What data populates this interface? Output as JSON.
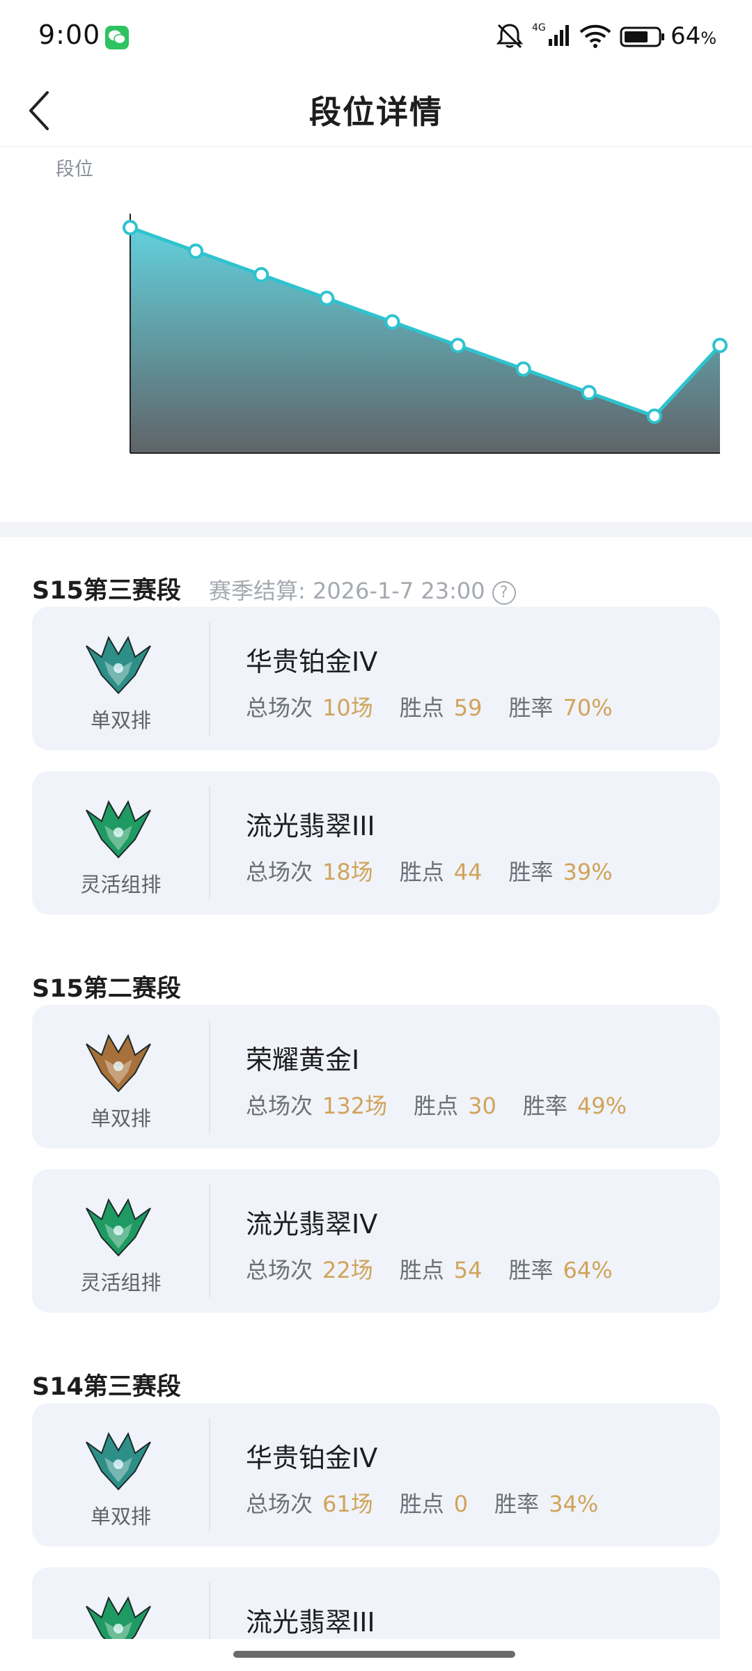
{
  "status_bar": {
    "time": "9:00",
    "network": "4G",
    "battery_percent": "64",
    "battery_unit": "%"
  },
  "header": {
    "title": "段位详情"
  },
  "chart_data": {
    "type": "area",
    "ylabel": "段位",
    "xlabel": "",
    "title": "",
    "x": [
      1,
      2,
      3,
      4,
      5,
      6,
      7,
      8,
      9,
      10
    ],
    "series": [
      {
        "values": [
          10,
          9,
          8,
          7,
          6,
          5,
          4,
          3,
          2,
          5
        ]
      }
    ],
    "grid": false,
    "colors": {
      "line": "#2ec3cf",
      "fill_top": "#63d0dc",
      "fill_bottom": "#5f6468"
    }
  },
  "seasons": [
    {
      "title": "S15第三赛段",
      "settle_text": "赛季结算: 2026-1-7 23:00",
      "help": "?",
      "cards": [
        {
          "emblem": "platinum",
          "queue": "单双排",
          "rank": "华贵铂金IV",
          "games_label": "总场次",
          "games": "10场",
          "points_label": "胜点",
          "points": "59",
          "winrate_label": "胜率",
          "winrate": "70%"
        },
        {
          "emblem": "emerald",
          "queue": "灵活组排",
          "rank": "流光翡翠III",
          "games_label": "总场次",
          "games": "18场",
          "points_label": "胜点",
          "points": "44",
          "winrate_label": "胜率",
          "winrate": "39%"
        }
      ]
    },
    {
      "title": "S15第二赛段",
      "settle_text": "",
      "help": "",
      "cards": [
        {
          "emblem": "gold",
          "queue": "单双排",
          "rank": "荣耀黄金I",
          "games_label": "总场次",
          "games": "132场",
          "points_label": "胜点",
          "points": "30",
          "winrate_label": "胜率",
          "winrate": "49%"
        },
        {
          "emblem": "emerald",
          "queue": "灵活组排",
          "rank": "流光翡翠IV",
          "games_label": "总场次",
          "games": "22场",
          "points_label": "胜点",
          "points": "54",
          "winrate_label": "胜率",
          "winrate": "64%"
        }
      ]
    },
    {
      "title": "S14第三赛段",
      "settle_text": "",
      "help": "",
      "cards": [
        {
          "emblem": "platinum",
          "queue": "单双排",
          "rank": "华贵铂金IV",
          "games_label": "总场次",
          "games": "61场",
          "points_label": "胜点",
          "points": "0",
          "winrate_label": "胜率",
          "winrate": "34%"
        },
        {
          "emblem": "emerald",
          "queue": "",
          "rank": "流光翡翠III",
          "games_label": "",
          "games": "",
          "points_label": "",
          "points": "",
          "winrate_label": "",
          "winrate": ""
        }
      ]
    }
  ],
  "emblem_colors": {
    "platinum": "#2e8f88",
    "emerald": "#1f9a62",
    "gold": "#a8703a"
  }
}
